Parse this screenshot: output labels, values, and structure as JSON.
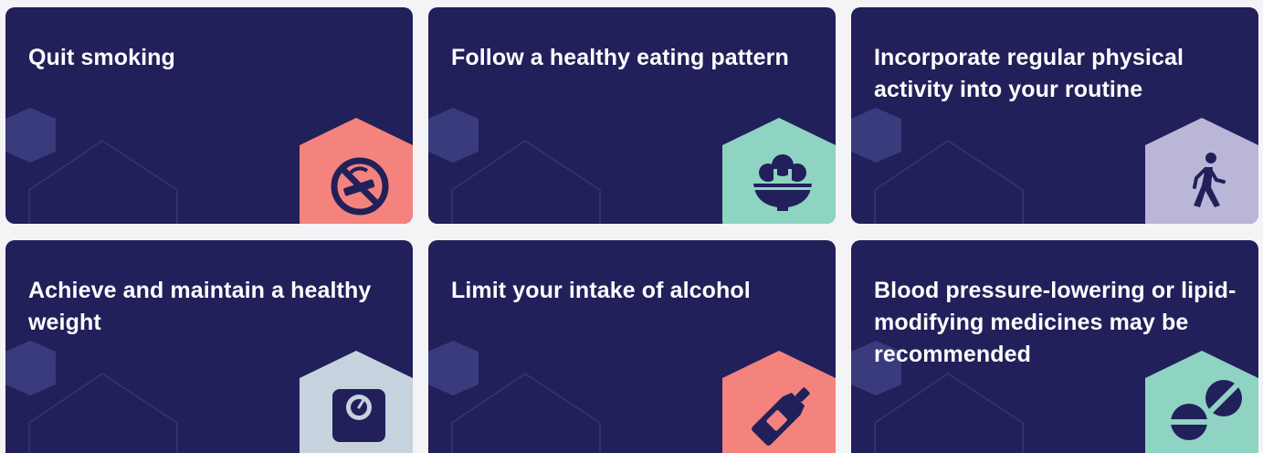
{
  "cards": [
    {
      "title": "Quit smoking",
      "icon": "no-smoking-icon",
      "color": "#f4837d"
    },
    {
      "title": "Follow a healthy eating pattern",
      "icon": "salad-bowl-icon",
      "color": "#8fd3c3"
    },
    {
      "title": "Incorporate regular physical activity into your routine",
      "icon": "walking-person-icon",
      "color": "#b9b6d8"
    },
    {
      "title": "Achieve and maintain a healthy weight",
      "icon": "scale-icon",
      "color": "#c7d2df"
    },
    {
      "title": "Limit your intake of alcohol",
      "icon": "bottle-icon",
      "color": "#f4837d"
    },
    {
      "title": "Blood pressure-lowering or lipid-modifying medicines may be recommended",
      "icon": "pills-icon",
      "color": "#8fd3c3"
    }
  ],
  "colors": {
    "card_background": "#22205a",
    "page_background": "#f4f4f7",
    "decor_hexagon": "#3a3b7d",
    "decor_outline": "#34357a",
    "icon_foreground": "#22205a"
  }
}
